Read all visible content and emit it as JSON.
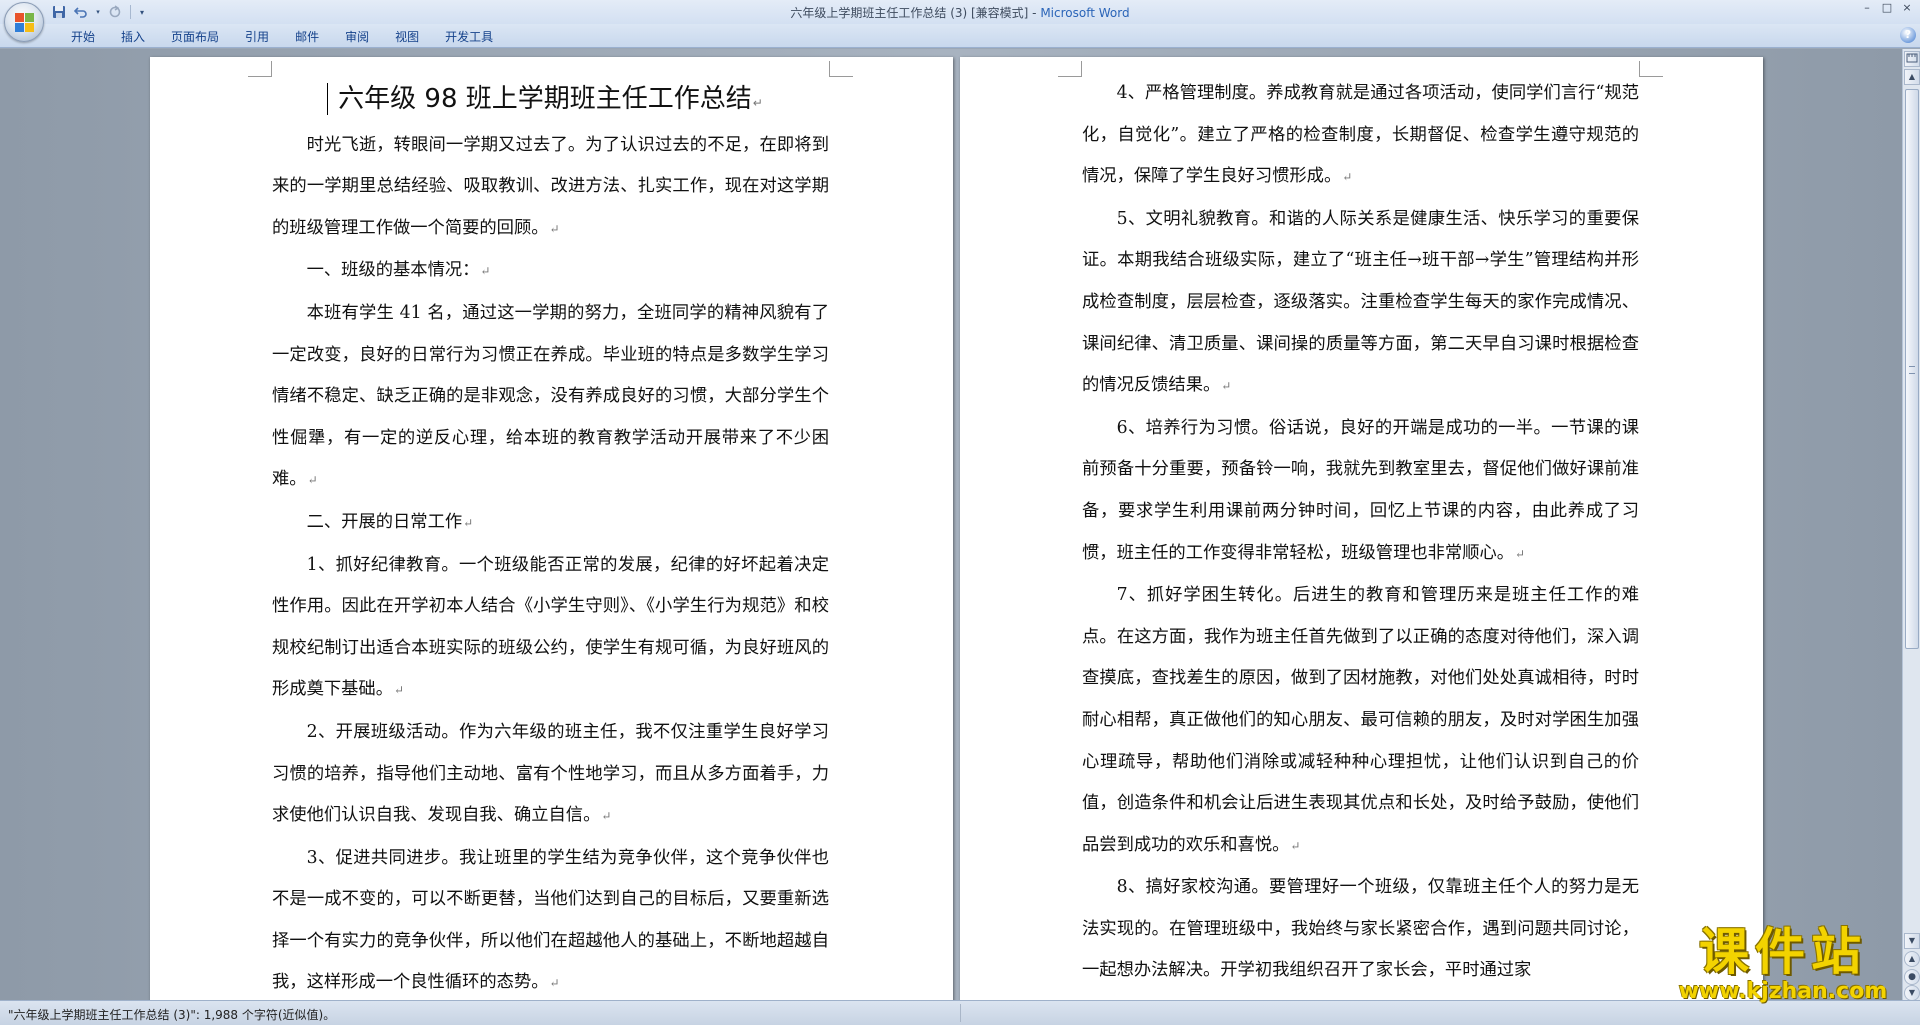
{
  "window": {
    "title_doc": "六年级上学期班主任工作总结 (3) [兼容模式] - ",
    "title_app": "Microsoft Word",
    "minimize": "–",
    "maximize": "□",
    "close": "×"
  },
  "quick_access": {
    "save_icon": "save-icon",
    "undo_icon": "undo-icon",
    "redo_icon": "redo-icon",
    "customize_icon": "dropdown-icon"
  },
  "ribbon": {
    "tabs": [
      "开始",
      "插入",
      "页面布局",
      "引用",
      "邮件",
      "审阅",
      "视图",
      "开发工具"
    ],
    "help": "?"
  },
  "document": {
    "title": "六年级 98 班上学期班主任工作总结",
    "paragraph_mark": "↵",
    "page1": [
      "时光飞逝，转眼间一学期又过去了。为了认识过去的不足，在即将到来的一学期里总结经验、吸取教训、改进方法、扎实工作，现在对这学期的班级管理工作做一个简要的回顾。",
      "一、班级的基本情况：",
      "本班有学生 41 名，通过这一学期的努力，全班同学的精神风貌有了一定改变，良好的日常行为习惯正在养成。毕业班的特点是多数学生学习情绪不稳定、缺乏正确的是非观念，没有养成良好的习惯，大部分学生个性倔犟，有一定的逆反心理，给本班的教育教学活动开展带来了不少困难。",
      "二、开展的日常工作",
      "1、抓好纪律教育。一个班级能否正常的发展，纪律的好坏起着决定性作用。因此在开学初本人结合《小学生守则》、《小学生行为规范》和校规校纪制订出适合本班实际的班级公约，使学生有规可循，为良好班风的形成奠下基础。",
      "2、开展班级活动。作为六年级的班主任，我不仅注重学生良好学习习惯的培养，指导他们主动地、富有个性地学习，而且从多方面着手，力求使他们认识自我、发现自我、确立自信。",
      "3、促进共同进步。我让班里的学生结为竞争伙伴，这个竞争伙伴也不是一成不变的，可以不断更替，当他们达到自己的目标后，又要重新选择一个有实力的竞争伙伴，所以他们在超越他人的基础上，不断地超越自我，这样形成一个良性循环的态势。"
    ],
    "page2": [
      "4、严格管理制度。养成教育就是通过各项活动，使同学们言行“规范化，自觉化”。建立了严格的检查制度，长期督促、检查学生遵守规范的情况，保障了学生良好习惯形成。",
      "5、文明礼貌教育。和谐的人际关系是健康生活、快乐学习的重要保证。本期我结合班级实际，建立了“班主任→班干部→学生”管理结构并形成检查制度，层层检查，逐级落实。注重检查学生每天的家作完成情况、课间纪律、清卫质量、课间操的质量等方面，第二天早自习课时根据检查的情况反馈结果。",
      "6、培养行为习惯。俗话说，良好的开端是成功的一半。一节课的课前预备十分重要，预备铃一响，我就先到教室里去，督促他们做好课前准备，要求学生利用课前两分钟时间，回忆上节课的内容，由此养成了习惯，班主任的工作变得非常轻松，班级管理也非常顺心。",
      "7、抓好学困生转化。后进生的教育和管理历来是班主任工作的难点。在这方面，我作为班主任首先做到了以正确的态度对待他们，深入调查摸底，查找差生的原因，做到了因材施教，对他们处处真诚相待，时时耐心相帮，真正做他们的知心朋友、最可信赖的朋友，及时对学困生加强心理疏导，帮助他们消除或减轻种种心理担忧，让他们认识到自己的价值，创造条件和机会让后进生表现其优点和长处，及时给予鼓励，使他们品尝到成功的欢乐和喜悦。",
      "8、搞好家校沟通。要管理好一个班级，仅靠班主任个人的努力是无法实现的。在管理班级中，我始终与家长紧密合作，遇到问题共同讨论，一起想办法解决。开学初我组织召开了家长会，平时通过家"
    ]
  },
  "scrollbar": {
    "up": "▲",
    "down": "▼",
    "prev_page": "▲",
    "select_browse": "●",
    "next_page": "▼",
    "position_fraction": 0.0
  },
  "status": {
    "text": "\"六年级上学期班主任工作总结 (3)\": 1,988 个字符(近似值)。"
  },
  "watermark": {
    "brand": "课件站",
    "url": "www.kjzhan.com"
  }
}
